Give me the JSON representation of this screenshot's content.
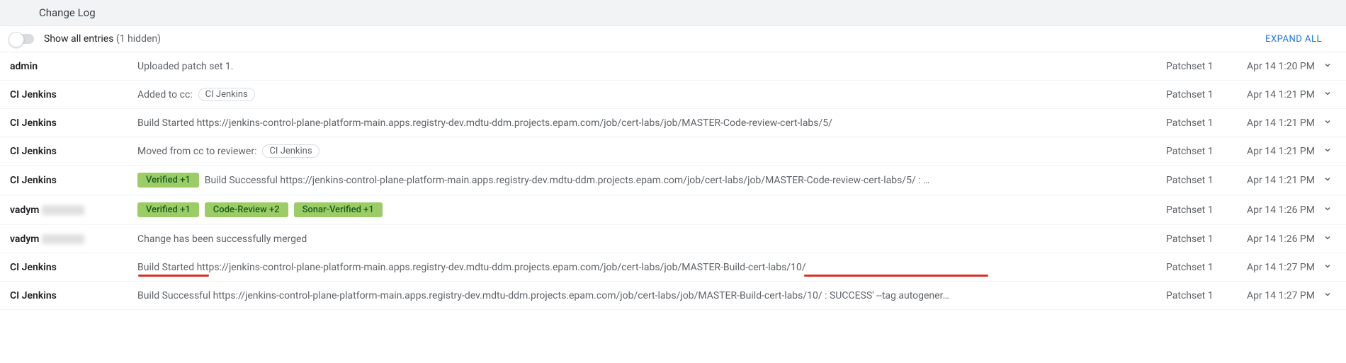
{
  "header": {
    "title": "Change Log"
  },
  "controls": {
    "show_label": "Show all entries",
    "hidden_label": "(1 hidden)",
    "expand_label": "EXPAND ALL"
  },
  "chips": {
    "ci_jenkins": "CI Jenkins"
  },
  "badges": {
    "verified": "Verified +1",
    "code_review": "Code-Review +2",
    "sonar": "Sonar-Verified +1"
  },
  "entries": [
    {
      "author": "admin",
      "type": "text",
      "message": "Uploaded patch set 1.",
      "patchset": "Patchset 1",
      "time": "Apr 14 1:20 PM"
    },
    {
      "author": "CI Jenkins",
      "type": "cc",
      "prefix": "Added to cc:",
      "patchset": "Patchset 1",
      "time": "Apr 14 1:21 PM"
    },
    {
      "author": "CI Jenkins",
      "type": "text",
      "message": "Build Started https://jenkins-control-plane-platform-main.apps.registry-dev.mdtu-ddm.projects.epam.com/job/cert-labs/job/MASTER-Code-review-cert-labs/5/",
      "patchset": "Patchset 1",
      "time": "Apr 14 1:21 PM"
    },
    {
      "author": "CI Jenkins",
      "type": "reviewer",
      "prefix": "Moved from cc to reviewer:",
      "patchset": "Patchset 1",
      "time": "Apr 14 1:21 PM"
    },
    {
      "author": "CI Jenkins",
      "type": "verified_msg",
      "message": "Build Successful https://jenkins-control-plane-platform-main.apps.registry-dev.mdtu-ddm.projects.epam.com/job/cert-labs/job/MASTER-Code-review-cert-labs/5/ : …",
      "patchset": "Patchset 1",
      "time": "Apr 14 1:21 PM"
    },
    {
      "author": "vadym",
      "blur": true,
      "type": "three_badges",
      "patchset": "Patchset 1",
      "time": "Apr 14 1:26 PM"
    },
    {
      "author": "vadym",
      "blur": true,
      "type": "text",
      "message": "Change has been successfully merged",
      "patchset": "Patchset 1",
      "time": "Apr 14 1:26 PM"
    },
    {
      "author": "CI Jenkins",
      "type": "underlined",
      "message": "Build Started https://jenkins-control-plane-platform-main.apps.registry-dev.mdtu-ddm.projects.epam.com/job/cert-labs/job/MASTER-Build-cert-labs/10/",
      "patchset": "Patchset 1",
      "time": "Apr 14 1:27 PM"
    },
    {
      "author": "CI Jenkins",
      "type": "text",
      "message": "Build Successful https://jenkins-control-plane-platform-main.apps.registry-dev.mdtu-ddm.projects.epam.com/job/cert-labs/job/MASTER-Build-cert-labs/10/ : SUCCESS' --tag autogener…",
      "patchset": "Patchset 1",
      "time": "Apr 14 1:27 PM"
    }
  ]
}
